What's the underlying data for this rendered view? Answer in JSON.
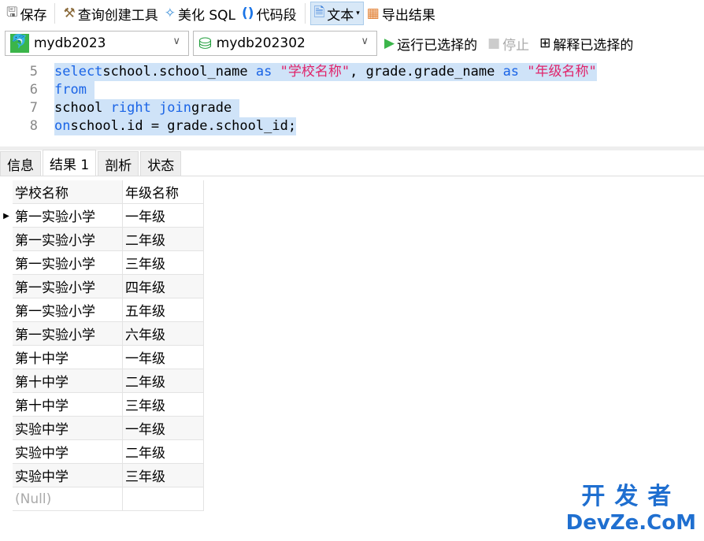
{
  "toolbar": {
    "save": "保存",
    "query_builder": "查询创建工具",
    "beautify": "美化 SQL",
    "snippet": "代码段",
    "text": "文本",
    "export": "导出结果"
  },
  "connection": {
    "server": "mydb2023",
    "database": "mydb202302",
    "run": "运行已选择的",
    "stop": "停止",
    "explain": "解释已选择的"
  },
  "editor": {
    "lines": [
      {
        "num": "5",
        "tokens": [
          [
            "kw",
            "select"
          ],
          [
            "",
            "school.school_name "
          ],
          [
            "kw",
            "as"
          ],
          [
            "str",
            " \"学校名称\""
          ],
          [
            "",
            ", grade.grade_name "
          ],
          [
            "kw",
            "as"
          ],
          [
            "str",
            " \"年级名称\""
          ]
        ]
      },
      {
        "num": "6",
        "tokens": [
          [
            "kw",
            "from"
          ]
        ]
      },
      {
        "num": "7",
        "tokens": [
          [
            "",
            "school "
          ],
          [
            "kw",
            "right join"
          ],
          [
            "",
            ""
          ],
          [
            "",
            "grade"
          ]
        ]
      },
      {
        "num": "8",
        "tokens": [
          [
            "kw",
            "on"
          ],
          [
            "",
            ""
          ],
          [
            "",
            "school.id = grade.school_id;"
          ]
        ]
      }
    ]
  },
  "tabs": [
    "信息",
    "结果 1",
    "剖析",
    "状态"
  ],
  "grid": {
    "columns": [
      "学校名称",
      "年级名称"
    ],
    "rows": [
      [
        "第一实验小学",
        "一年级"
      ],
      [
        "第一实验小学",
        "二年级"
      ],
      [
        "第一实验小学",
        "三年级"
      ],
      [
        "第一实验小学",
        "四年级"
      ],
      [
        "第一实验小学",
        "五年级"
      ],
      [
        "第一实验小学",
        "六年级"
      ],
      [
        "第十中学",
        "一年级"
      ],
      [
        "第十中学",
        "二年级"
      ],
      [
        "第十中学",
        "三年级"
      ],
      [
        "实验中学",
        "一年级"
      ],
      [
        "实验中学",
        "二年级"
      ],
      [
        "实验中学",
        "三年级"
      ],
      [
        "(Null)",
        ""
      ]
    ]
  },
  "watermark": {
    "line1": "开发者",
    "line2": "DevZe.CoM"
  }
}
